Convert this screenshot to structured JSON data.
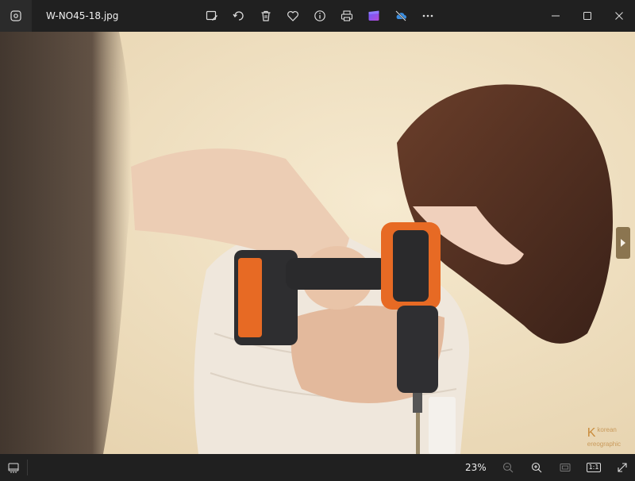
{
  "window": {
    "title": "W-NO45-18.jpg",
    "app_icon": "photos-app-icon"
  },
  "toolbar": {
    "items": [
      {
        "name": "edit-image",
        "icon": "edit-image-icon"
      },
      {
        "name": "rotate",
        "icon": "rotate-icon"
      },
      {
        "name": "delete",
        "icon": "trash-icon"
      },
      {
        "name": "favorite",
        "icon": "heart-icon"
      },
      {
        "name": "file-info",
        "icon": "info-icon"
      },
      {
        "name": "print",
        "icon": "print-icon"
      },
      {
        "name": "clipchamp",
        "icon": "clipchamp-icon"
      },
      {
        "name": "onedrive",
        "icon": "cloud-off-icon"
      },
      {
        "name": "more",
        "icon": "more-icon"
      }
    ]
  },
  "window_controls": [
    "minimize-icon",
    "maximize-icon",
    "close-icon"
  ],
  "viewer": {
    "next_icon": "chevron-right-icon",
    "watermark_mark": "K",
    "watermark_line1": "korean",
    "watermark_line2": "ereographic"
  },
  "statusbar": {
    "zoom": "23%",
    "filmstrip_icon": "filmstrip-icon",
    "zoom_out_icon": "zoom-out-icon",
    "zoom_in_icon": "zoom-in-icon",
    "fit_icon": "fit-to-window-icon",
    "actual_size_label": "1:1",
    "fullscreen_icon": "fullscreen-icon"
  },
  "colors": {
    "chrome": "#202020",
    "background": "#efe3c9",
    "next_button": "#8b7550"
  }
}
